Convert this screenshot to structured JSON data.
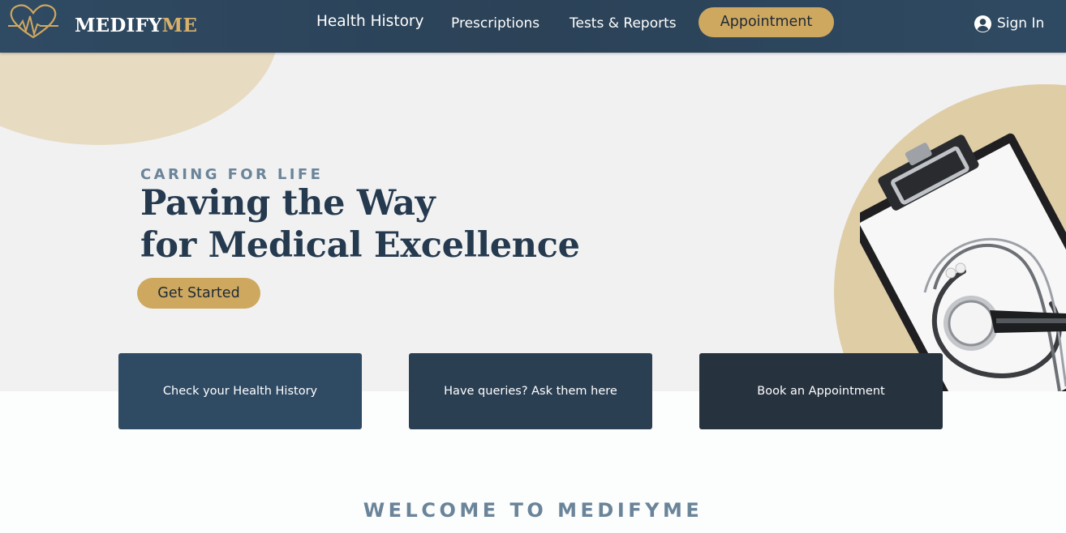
{
  "nav": {
    "brand_main": "MEDIFY",
    "brand_accent": "ME",
    "links": [
      {
        "label": "Health History"
      },
      {
        "label": "Prescriptions"
      },
      {
        "label": "Tests & Reports"
      }
    ],
    "appointment_label": "Appointment",
    "signin_label": "Sign In"
  },
  "hero": {
    "eyebrow": "CARING FOR LIFE",
    "headline_line1": "Paving the Way",
    "headline_line2": "for Medical Excellence",
    "cta_label": "Get Started"
  },
  "cards": [
    {
      "label": "Check your Health History"
    },
    {
      "label": "Have queries? Ask them here"
    },
    {
      "label": "Book an Appointment"
    }
  ],
  "welcome": {
    "title": "WELCOME TO MEDIFYME"
  },
  "colors": {
    "nav_bg": "#2f4a63",
    "accent_gold": "#cfa860",
    "heading_navy": "#253a4e",
    "eyebrow_slate": "#6a8499"
  },
  "icons": {
    "logo": "heart-pulse-icon",
    "signin": "user-circle-icon",
    "illustration": "clipboard-stethoscope"
  }
}
